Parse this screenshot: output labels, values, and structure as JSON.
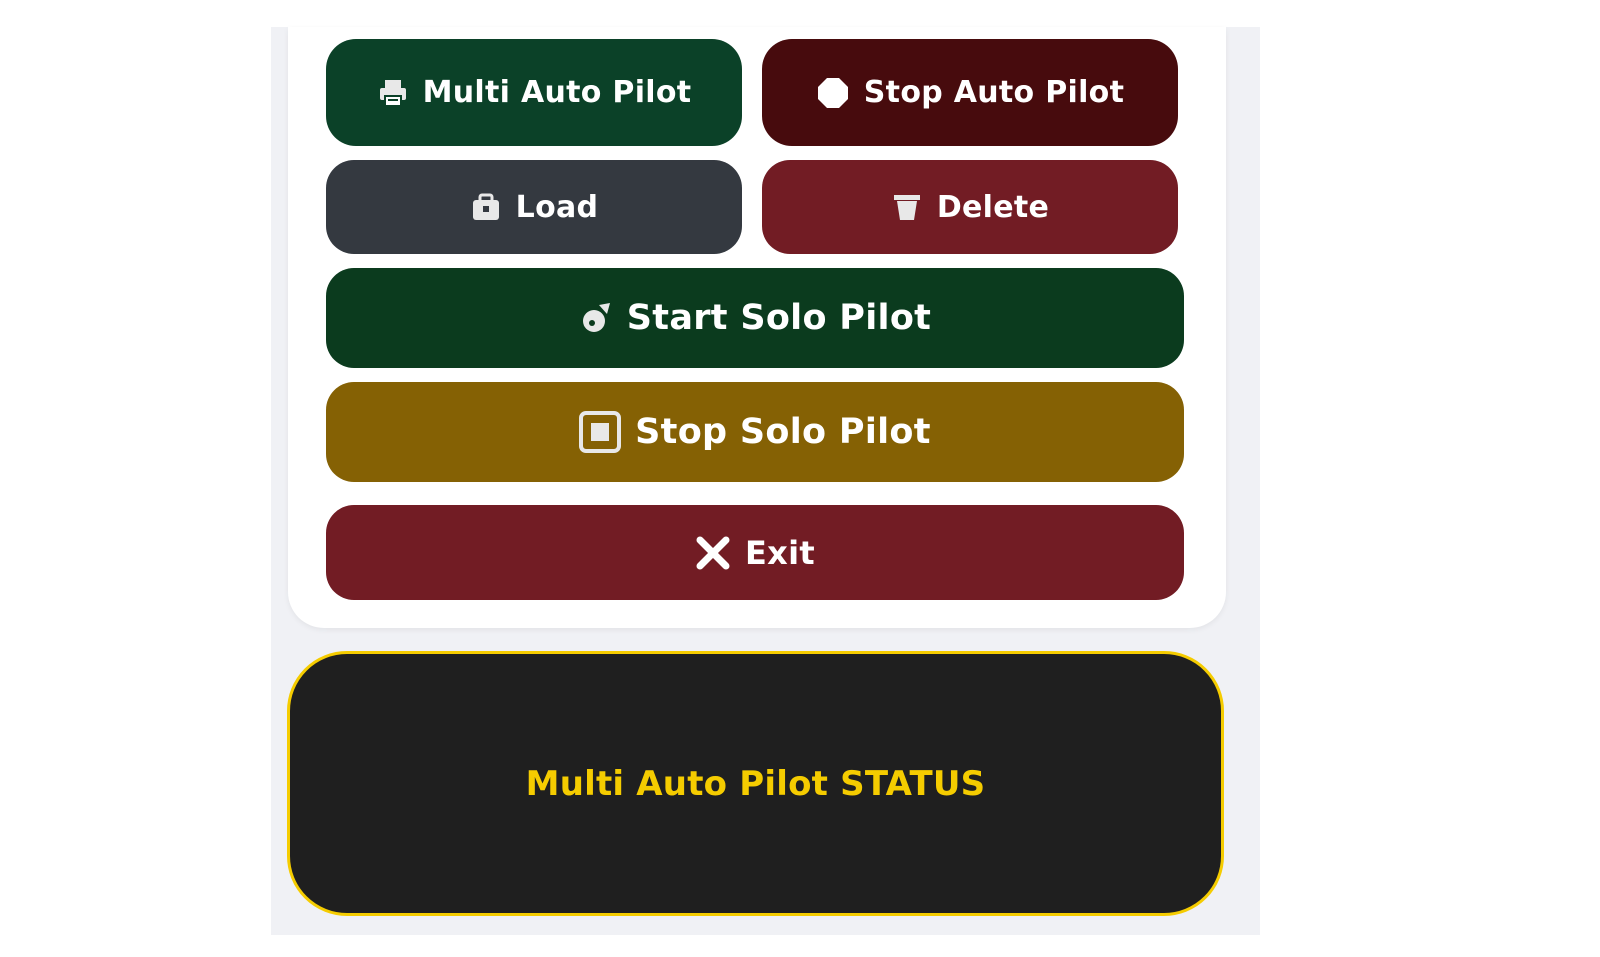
{
  "buttons": {
    "multi_auto_pilot": {
      "label": "Multi Auto Pilot",
      "icon": "printer-icon",
      "color": "#0b4128"
    },
    "stop_auto_pilot": {
      "label": "Stop Auto Pilot",
      "icon": "stop-circle-icon",
      "color": "#470b0d"
    },
    "load": {
      "label": "Load",
      "icon": "folder-open-icon",
      "color": "#343940"
    },
    "delete": {
      "label": "Delete",
      "icon": "trash-icon",
      "color": "#721c24"
    },
    "start_solo_pilot": {
      "label": "Start Solo Pilot",
      "icon": "rocket-icon",
      "color": "#0b3b1e"
    },
    "stop_solo_pilot": {
      "label": "Stop Solo Pilot",
      "icon": "stop-square-icon",
      "color": "#856104"
    },
    "exit": {
      "label": "Exit",
      "icon": "close-icon",
      "color": "#721c24"
    }
  },
  "status": {
    "text": "Multi Auto Pilot STATUS",
    "text_color": "#f5cc00",
    "background": "#1f1f1f"
  }
}
